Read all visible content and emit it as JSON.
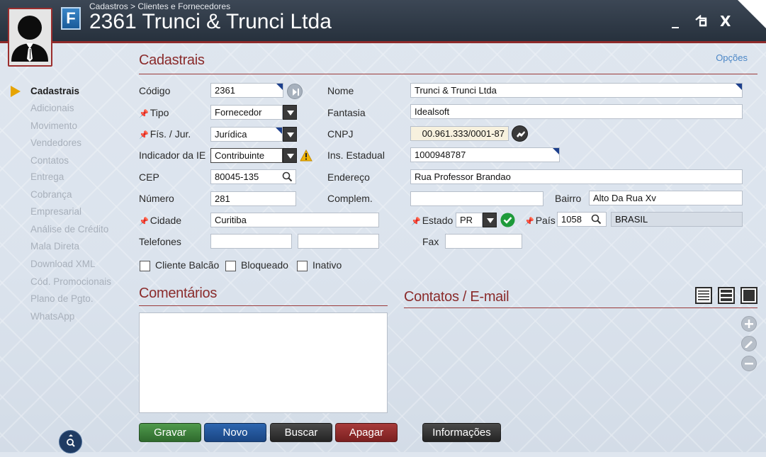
{
  "header": {
    "breadcrumb": "Cadastros > Clientes e Fornecedores",
    "app_letter": "F",
    "record_code": "2361",
    "record_name": "Trunci & Trunci Ltda",
    "minimize": "_",
    "restore": "⮌",
    "close": "X"
  },
  "options_link": "Opções",
  "sidebar": {
    "items": [
      {
        "label": "Cadastrais"
      },
      {
        "label": "Adicionais"
      },
      {
        "label": "Movimento"
      },
      {
        "label": "Vendedores"
      },
      {
        "label": "Contatos"
      },
      {
        "label": "Entrega"
      },
      {
        "label": "Cobrança"
      },
      {
        "label": "Empresarial"
      },
      {
        "label": "Análise de Crédito"
      },
      {
        "label": "Mala Direta"
      },
      {
        "label": "Download XML"
      },
      {
        "label": "Cód. Promocionais"
      },
      {
        "label": "Plano de Pgto."
      },
      {
        "label": "WhatsApp"
      }
    ]
  },
  "sections": {
    "cadastrais": "Cadastrais",
    "comentarios": "Comentários",
    "contatos": "Contatos / E-mail"
  },
  "labels": {
    "codigo": "Código",
    "tipo": "Tipo",
    "fis_jur": "Fís. / Jur.",
    "indicador_ie": "Indicador da IE",
    "cep": "CEP",
    "numero": "Número",
    "cidade": "Cidade",
    "telefones": "Telefones",
    "nome": "Nome",
    "fantasia": "Fantasia",
    "cnpj": "CNPJ",
    "ins_estadual": "Ins. Estadual",
    "endereco": "Endereço",
    "complem": "Complem.",
    "bairro": "Bairro",
    "estado": "Estado",
    "pais": "País",
    "fax": "Fax"
  },
  "values": {
    "codigo": "2361",
    "tipo": "Fornecedor",
    "fis_jur": "Jurídica",
    "indicador_ie": "Contribuinte",
    "cep": "80045-135",
    "numero": "281",
    "cidade": "Curitiba",
    "telefone1": "",
    "telefone2": "",
    "nome": "Trunci & Trunci Ltda",
    "fantasia": "Idealsoft",
    "cnpj": "00.961.333/0001-87",
    "ins_estadual": "1000948787",
    "endereco": "Rua Professor Brandao",
    "complem": "",
    "bairro": "Alto Da Rua Xv",
    "estado": "PR",
    "pais_codigo": "1058",
    "pais_nome": "BRASIL",
    "fax": "",
    "comentarios": ""
  },
  "checkboxes": [
    {
      "label": "Cliente Balcão",
      "checked": false
    },
    {
      "label": "Bloqueado",
      "checked": false
    },
    {
      "label": "Inativo",
      "checked": false
    }
  ],
  "buttons": {
    "gravar": "Gravar",
    "novo": "Novo",
    "buscar": "Buscar",
    "apagar": "Apagar",
    "informacoes": "Informações"
  },
  "colors": {
    "accent_red": "#8a2b2b",
    "link_blue": "#4a86c6",
    "gravar": "#3b7a3a",
    "novo": "#1f4f8e",
    "buscar": "#2e2e2e",
    "apagar": "#8e2a2a",
    "informacoes": "#333333"
  }
}
